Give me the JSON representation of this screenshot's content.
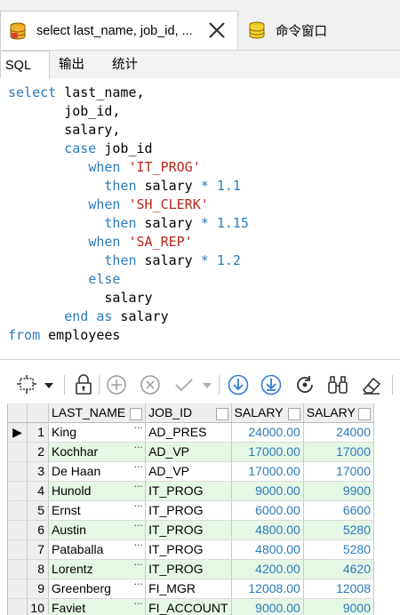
{
  "doc_tabs": [
    {
      "label": "select last_name, job_id, ...",
      "active": true
    },
    {
      "label": "命令窗口",
      "active": false
    }
  ],
  "inner_tabs": [
    "SQL",
    "输出",
    "统计"
  ],
  "sql_lines": [
    [
      [
        "kw",
        "select"
      ],
      [
        "t",
        " last_name,"
      ]
    ],
    [
      [
        "t",
        "       job_id,"
      ]
    ],
    [
      [
        "t",
        "       salary,"
      ]
    ],
    [
      [
        "t",
        "       "
      ],
      [
        "kw",
        "case"
      ],
      [
        "t",
        " job_id"
      ]
    ],
    [
      [
        "t",
        "          "
      ],
      [
        "kw",
        "when"
      ],
      [
        "t",
        " "
      ],
      [
        "str",
        "'IT_PROG'"
      ]
    ],
    [
      [
        "t",
        "            "
      ],
      [
        "kw",
        "then"
      ],
      [
        "t",
        " salary "
      ],
      [
        "op",
        "*"
      ],
      [
        "t",
        " "
      ],
      [
        "num",
        "1.1"
      ]
    ],
    [
      [
        "t",
        "          "
      ],
      [
        "kw",
        "when"
      ],
      [
        "t",
        " "
      ],
      [
        "str",
        "'SH_CLERK'"
      ]
    ],
    [
      [
        "t",
        "            "
      ],
      [
        "kw",
        "then"
      ],
      [
        "t",
        " salary "
      ],
      [
        "op",
        "*"
      ],
      [
        "t",
        " "
      ],
      [
        "num",
        "1.15"
      ]
    ],
    [
      [
        "t",
        "          "
      ],
      [
        "kw",
        "when"
      ],
      [
        "t",
        " "
      ],
      [
        "str",
        "'SA_REP'"
      ]
    ],
    [
      [
        "t",
        "            "
      ],
      [
        "kw",
        "then"
      ],
      [
        "t",
        " salary "
      ],
      [
        "op",
        "*"
      ],
      [
        "t",
        " "
      ],
      [
        "num",
        "1.2"
      ]
    ],
    [
      [
        "t",
        "          "
      ],
      [
        "kw",
        "else"
      ]
    ],
    [
      [
        "t",
        "            salary"
      ]
    ],
    [
      [
        "t",
        "       "
      ],
      [
        "kw",
        "end"
      ],
      [
        "t",
        " "
      ],
      [
        "kw",
        "as"
      ],
      [
        "t",
        " salary"
      ]
    ],
    [
      [
        "kw",
        "from"
      ],
      [
        "t",
        " employees"
      ]
    ]
  ],
  "toolbar_icons": [
    "grid-select-icon",
    "dropdown-arrow-icon",
    "lock-icon",
    "add-row-icon",
    "delete-row-icon",
    "post-changes-icon",
    "post-dropdown-icon",
    "fetch-next-icon",
    "fetch-all-icon",
    "refresh-icon",
    "binoculars-icon",
    "clear-icon"
  ],
  "table": {
    "columns": [
      "LAST_NAME",
      "JOB_ID",
      "SALARY",
      "SALARY"
    ],
    "rows": [
      [
        "1",
        "King",
        "AD_PRES",
        "24000.00",
        "24000"
      ],
      [
        "2",
        "Kochhar",
        "AD_VP",
        "17000.00",
        "17000"
      ],
      [
        "3",
        "De Haan",
        "AD_VP",
        "17000.00",
        "17000"
      ],
      [
        "4",
        "Hunold",
        "IT_PROG",
        "9000.00",
        "9900"
      ],
      [
        "5",
        "Ernst",
        "IT_PROG",
        "6000.00",
        "6600"
      ],
      [
        "6",
        "Austin",
        "IT_PROG",
        "4800.00",
        "5280"
      ],
      [
        "7",
        "Pataballa",
        "IT_PROG",
        "4800.00",
        "5280"
      ],
      [
        "8",
        "Lorentz",
        "IT_PROG",
        "4200.00",
        "4620"
      ],
      [
        "9",
        "Greenberg",
        "FI_MGR",
        "12008.00",
        "12008"
      ],
      [
        "10",
        "Faviet",
        "FI_ACCOUNT",
        "9000.00",
        "9000"
      ]
    ],
    "current_row_marker": "▶",
    "cell_button": "···"
  },
  "colors": {
    "keyword": "#2b7bba",
    "string": "#b5261b",
    "alt_row": "#e6f7e6",
    "icon_blue": "#2f7bd6"
  }
}
